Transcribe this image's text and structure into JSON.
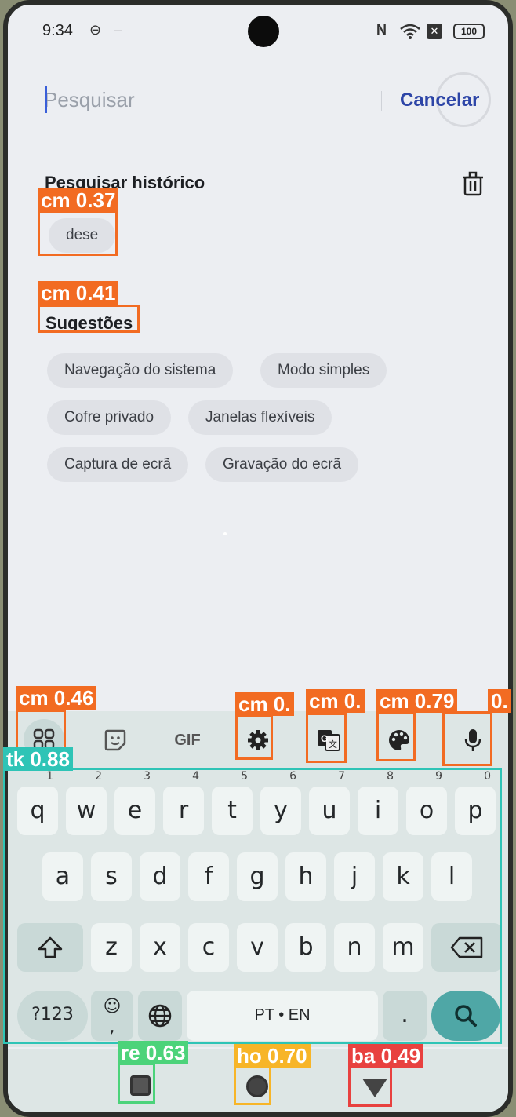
{
  "status": {
    "time": "9:34",
    "battery": "100"
  },
  "search": {
    "placeholder": "Pesquisar",
    "cancel_label": "Cancelar"
  },
  "history": {
    "title": "Pesquisar histórico",
    "items": [
      "dese"
    ]
  },
  "suggestions": {
    "title": "Sugestões",
    "items": [
      "Navegação do sistema",
      "Modo simples",
      "Cofre privado",
      "Janelas flexíveis",
      "Captura de ecrã",
      "Gravação do ecrã"
    ]
  },
  "keyboard": {
    "toolbar": {
      "gif_label": "GIF"
    },
    "row1": [
      {
        "k": "q",
        "n": "1"
      },
      {
        "k": "w",
        "n": "2"
      },
      {
        "k": "e",
        "n": "3"
      },
      {
        "k": "r",
        "n": "4"
      },
      {
        "k": "t",
        "n": "5"
      },
      {
        "k": "y",
        "n": "6"
      },
      {
        "k": "u",
        "n": "7"
      },
      {
        "k": "i",
        "n": "8"
      },
      {
        "k": "o",
        "n": "9"
      },
      {
        "k": "p",
        "n": "0"
      }
    ],
    "row2": [
      "a",
      "s",
      "d",
      "f",
      "g",
      "h",
      "j",
      "k",
      "l"
    ],
    "row3": [
      "z",
      "x",
      "c",
      "v",
      "b",
      "n",
      "m"
    ],
    "symbols_label": "?123",
    "comma_label": ",",
    "space_label": "PT • EN",
    "period_label": "."
  },
  "annotations": {
    "history_chip": "cm 0.37",
    "suggestions_title": "cm 0.41",
    "apps_icon": "cm 0.46",
    "settings_icon": "cm 0.",
    "translate_icon": "cm 0.",
    "palette_icon": "cm 0.79",
    "mic_icon": "0.",
    "keyboard": "tk 0.88",
    "recents_button": "re 0.63",
    "home_button": "ho 0.70",
    "back_button": "ba 0.49"
  },
  "colors": {
    "accent": "#2d45a7",
    "box_orange": "#f26b22",
    "box_teal": "#2ec4b6",
    "box_green": "#4cd37a",
    "box_yellow": "#f7b528",
    "box_red": "#e8413f"
  }
}
